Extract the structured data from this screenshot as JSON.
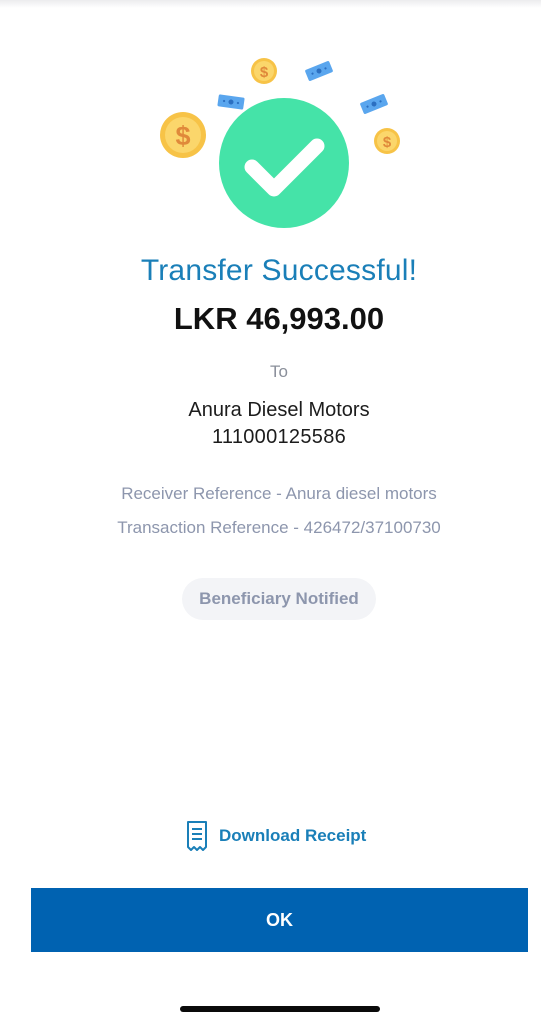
{
  "result": {
    "title": "Transfer Successful!",
    "amount": "LKR 46,993.00",
    "to_label": "To",
    "recipient_name": "Anura Diesel Motors",
    "recipient_account": "111000125586",
    "receiver_reference": "Receiver Reference - Anura diesel motors",
    "transaction_reference": "Transaction Reference - 426472/37100730",
    "status_badge": "Beneficiary Notified"
  },
  "actions": {
    "download_receipt_label": "Download Receipt",
    "ok_label": "OK"
  },
  "icons": {
    "success": "check-icon",
    "coins": "coin-icon",
    "banknotes": "banknote-icon",
    "receipt": "receipt-icon"
  },
  "colors": {
    "accent": "#1a7fb8",
    "success_green": "#45e3a8",
    "coin_gold": "#f7c347",
    "button_blue": "#0062b1",
    "muted_text": "#8d96ad"
  }
}
